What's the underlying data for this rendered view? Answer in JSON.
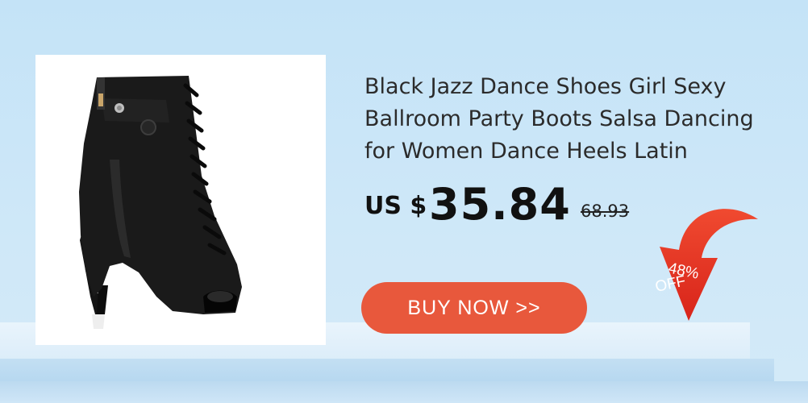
{
  "product": {
    "title": "Black Jazz Dance Shoes Girl Sexy Ballroom Party Boots Salsa Dancing for Women Dance Heels Latin",
    "currency": "US $",
    "price": "35.84",
    "original_price": "68.93"
  },
  "cta": {
    "label": "BUY NOW >>"
  },
  "discount": {
    "percent": "48%",
    "off": "OFF"
  },
  "colors": {
    "accent": "#e8583c",
    "arrow_red": "#e62e21",
    "background": "#c4e3f7"
  },
  "icons": {
    "arrow": "curved-down-arrow-icon",
    "product": "black-lace-up-boot"
  }
}
